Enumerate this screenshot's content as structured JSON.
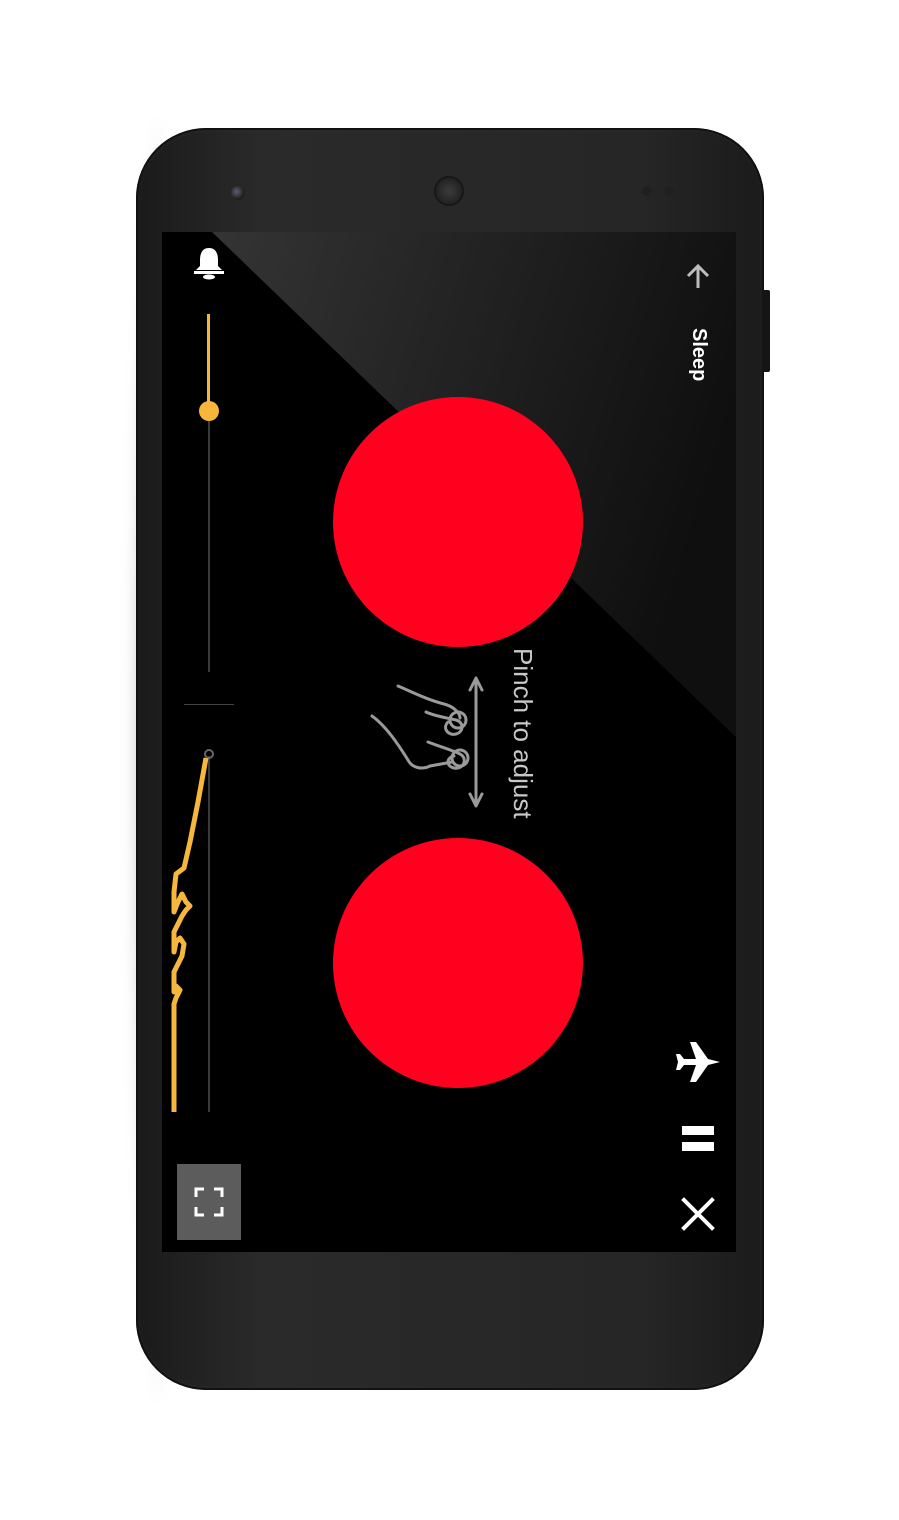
{
  "screen": {
    "sleep_label": "Sleep",
    "pinch_hint": "Pinch to adjust",
    "volume_level": 0.73
  },
  "icons": {
    "bell": "bell-icon",
    "up_arrow": "up-arrow-icon",
    "airplane": "airplane-icon",
    "pause": "pause-icon",
    "close": "close-icon",
    "fullscreen": "fullscreen-icon",
    "pinch_gesture": "pinch-gesture-icon"
  },
  "colors": {
    "accent": "#f6b73c",
    "circle": "#ff001e",
    "background": "#000000"
  }
}
